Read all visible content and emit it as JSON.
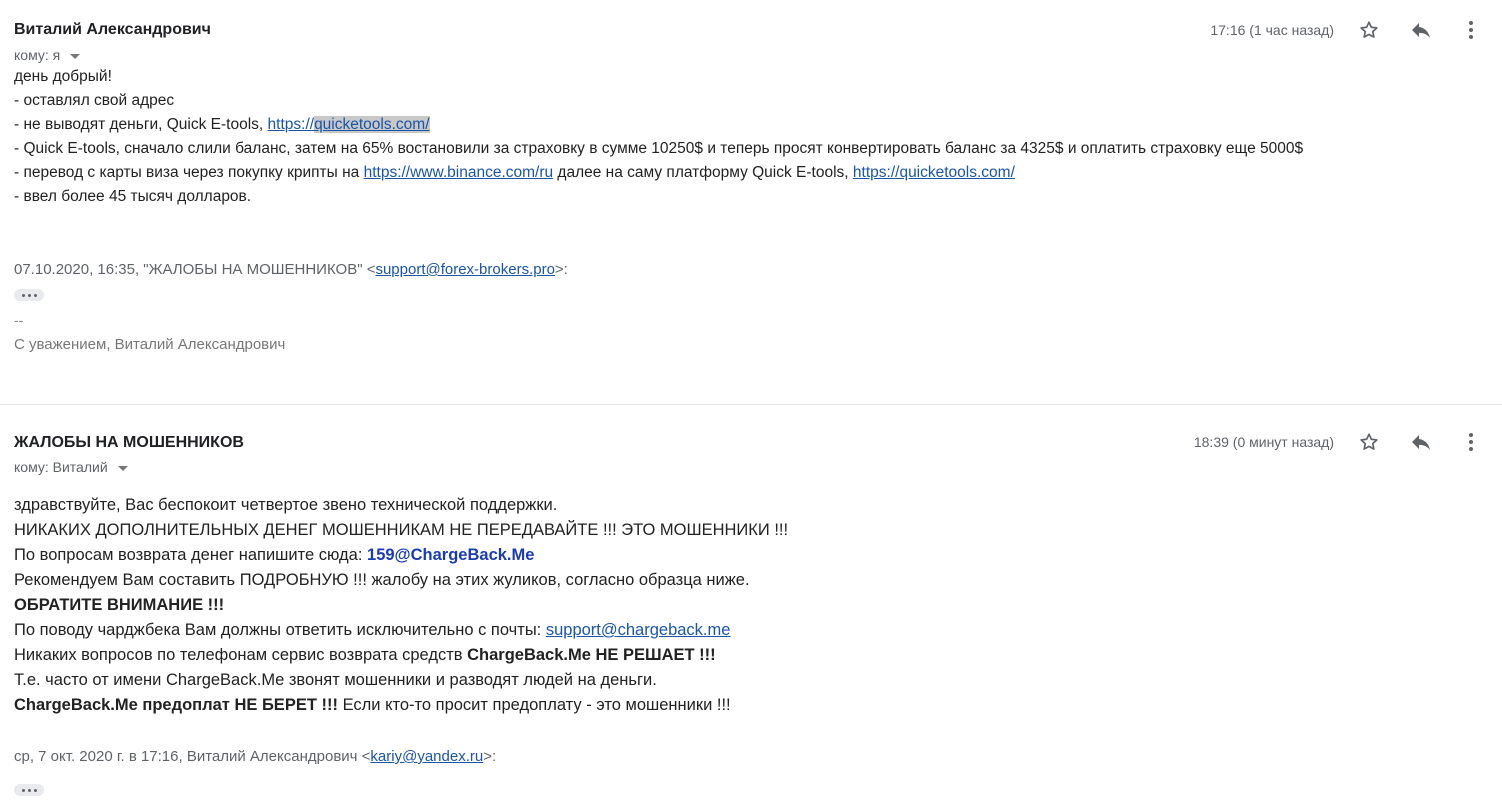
{
  "message1": {
    "sender": "Виталий Александрович",
    "recipient": "кому: я",
    "time": "17:16 (1 час назад)",
    "greeting": "день добрый!",
    "line1": "- оставлял свой адрес",
    "line2_prefix": "- не выводят деньги, Quick E-tools, ",
    "line2_link_a": "https://",
    "line2_link_b": "quicketools.com/",
    "line3": "- Quick E-tools, сначало слили баланс, затем на 65% востановили за страховку в сумме 10250$ и теперь просят конвертировать баланс за 4325$ и оплатить страховку еще 5000$",
    "line4_prefix": "- перевод с карты виза через покупку крипты на ",
    "line4_link1": "https://www.binance.com/ru",
    "line4_middle": " далее на саму платформу Quick E-tools, ",
    "line4_link2": "https://quicketools.com/",
    "line5": "- ввел более 45 тысяч долларов.",
    "quote_prefix": "07.10.2020, 16:35, \"ЖАЛОБЫ НА МОШЕННИКОВ\" <",
    "quote_email": "support@forex-brokers.pro",
    "quote_suffix": ">:",
    "sig_sep": "--",
    "signature": "С уважением, Виталий Александрович"
  },
  "message2": {
    "sender": "ЖАЛОБЫ НА МОШЕННИКОВ",
    "recipient": "кому: Виталий",
    "time": "18:39 (0 минут назад)",
    "l1": "здравствуйте, Вас беспокоит четвертое звено технической поддержки.",
    "l2": "НИКАКИХ ДОПОЛНИТЕЛЬНЫХ ДЕНЕГ МОШЕННИКАМ НЕ ПЕРЕДАВАЙТЕ !!! ЭТО МОШЕННИКИ !!!",
    "l3_prefix": "По вопросам возврата денег напишите сюда: ",
    "l3_email": "159@ChargeBack.Me",
    "l4": "Рекомендуем Вам составить ПОДРОБНУЮ !!! жалобу на этих жуликов, согласно образца ниже.",
    "l5": "ОБРАТИТЕ ВНИМАНИЕ !!!",
    "l6_prefix": "По поводу чарджбека Вам должны ответить исключительно с почты: ",
    "l6_email": "support@chargeback.me",
    "l7_prefix": "Никаких вопросов по телефонам сервис возврата средств ",
    "l7_bold": "ChargeBack.Me НЕ РЕШАЕТ !!!",
    "l8": "Т.е. часто от имени ChargeBack.Me звонят мошенники и разводят людей на деньги.",
    "l9_bold": "ChargeBack.Me предоплат НЕ БЕРЕТ !!!",
    "l9_suffix": " Если кто-то просит предоплату - это мошенники !!!",
    "quote_prefix": "ср, 7 окт. 2020 г. в 17:16, Виталий Александрович <",
    "quote_email": "kariy@yandex.ru",
    "quote_suffix": ">:"
  },
  "icons": {
    "star": "star-icon",
    "reply": "reply-icon",
    "more": "more-vert-icon",
    "expand": "ellipsis-icon"
  }
}
